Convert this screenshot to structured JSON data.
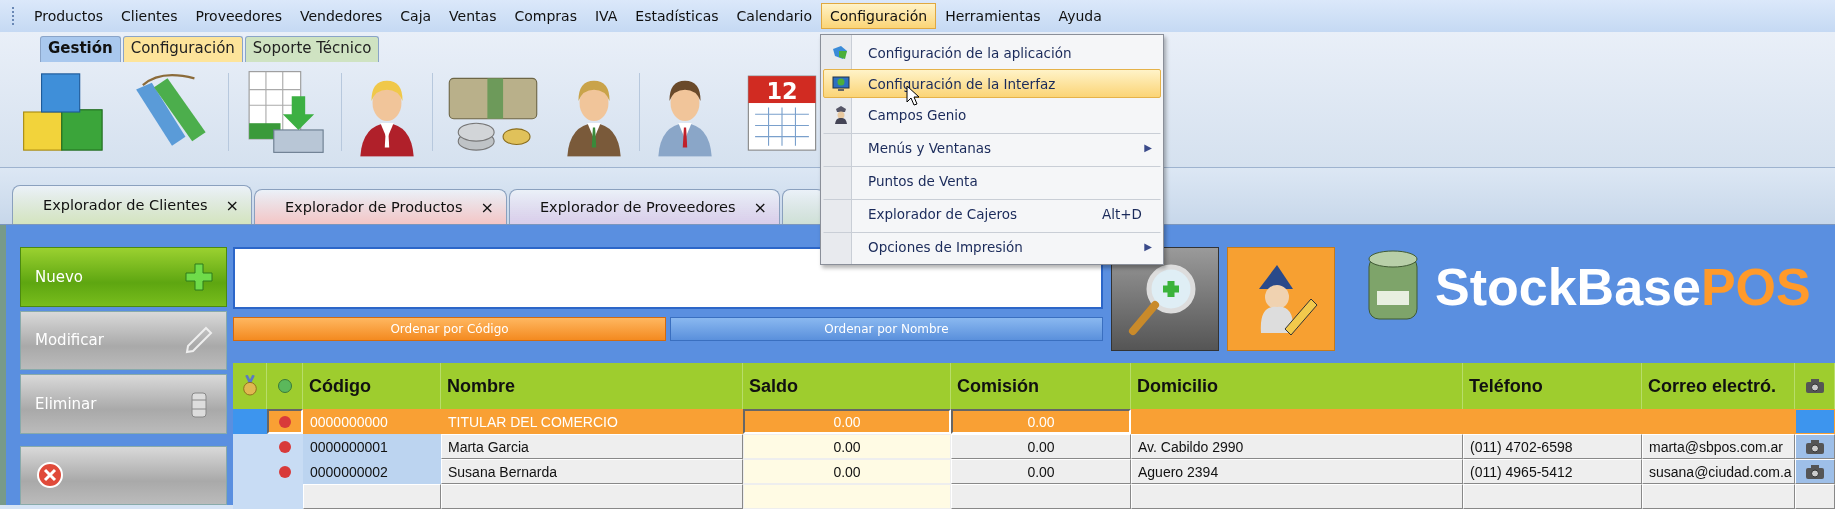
{
  "menu_bar": {
    "items": [
      {
        "label": "Productos",
        "selected": false
      },
      {
        "label": "Clientes",
        "selected": false
      },
      {
        "label": "Proveedores",
        "selected": false
      },
      {
        "label": "Vendedores",
        "selected": false
      },
      {
        "label": "Caja",
        "selected": false
      },
      {
        "label": "Ventas",
        "selected": false
      },
      {
        "label": "Compras",
        "selected": false
      },
      {
        "label": "IVA",
        "selected": false
      },
      {
        "label": "Estadísticas",
        "selected": false
      },
      {
        "label": "Calendario",
        "selected": false
      },
      {
        "label": "Configuración",
        "selected": true
      },
      {
        "label": "Herramientas",
        "selected": false
      },
      {
        "label": "Ayuda",
        "selected": false
      }
    ]
  },
  "dropdown": {
    "items": [
      {
        "label": "Configuración de la aplicación",
        "selected": false,
        "separator_before": false
      },
      {
        "label": "Configuración de la Interfaz",
        "selected": true,
        "separator_before": false
      },
      {
        "label": "Campos Genio",
        "selected": false,
        "separator_before": false
      },
      {
        "label": "Menús y Ventanas",
        "selected": false,
        "arrow": "▶",
        "separator_before": true
      },
      {
        "label": "Puntos de Venta",
        "selected": false,
        "separator_before": true
      },
      {
        "label": "Explorador de Cajeros",
        "shortcut": "Alt+D",
        "selected": false,
        "separator_before": true
      },
      {
        "label": "Opciones de Impresión",
        "selected": false,
        "arrow": "▶",
        "separator_before": true
      }
    ]
  },
  "calendar_day": "12",
  "ribbon_tabs": [
    {
      "label": "Gestión",
      "selected": true,
      "color": "#a9c8ee"
    },
    {
      "label": "Configuración",
      "selected": false,
      "color": "#fde49a"
    },
    {
      "label": "Soporte Técnico",
      "selected": false,
      "color": "#cfe3c2"
    }
  ],
  "document_tabs": [
    {
      "label": "Explorador de Clientes",
      "close": "×",
      "selected": true,
      "color": "#d4e4bf"
    },
    {
      "label": "Explorador de Productos",
      "close": "×",
      "selected": false,
      "color": "#f4c6c6"
    },
    {
      "label": "Explorador de Proveedores",
      "close": "×",
      "selected": false,
      "color": "#d9cdea"
    },
    {
      "selected": false,
      "color": "#cfe0d6"
    }
  ],
  "actions": [
    {
      "label": "Nuevo",
      "kind": "new"
    },
    {
      "label": "Modificar",
      "kind": "edit"
    },
    {
      "label": "Eliminar",
      "kind": "delete"
    },
    {
      "kind": "cancel"
    }
  ],
  "sort_buttons": [
    {
      "label": "Ordenar por Código",
      "selected": true
    },
    {
      "label": "Ordenar por Nombre",
      "selected": false
    }
  ],
  "logo": {
    "primary": "StockBase",
    "accent": "POS"
  },
  "table": {
    "columns": [
      "Código",
      "Nombre",
      "Saldo",
      "Comisión",
      "Domicilio",
      "Teléfono",
      "Correo electró."
    ],
    "rows": [
      {
        "selected": true,
        "color": "#d83a3a",
        "cells": [
          "0000000000",
          "TITULAR DEL COMERCIO",
          "0.00",
          "0.00",
          "",
          "",
          ""
        ],
        "photo": false
      },
      {
        "selected": false,
        "color": "#d83a3a",
        "cells": [
          "0000000001",
          "Marta Garcia",
          "0.00",
          "0.00",
          "Av. Cabildo 2990",
          "(011) 4702-6598",
          "marta@sbpos.com.ar"
        ],
        "photo": true
      },
      {
        "selected": false,
        "color": "#d83a3a",
        "cells": [
          "0000000002",
          "Susana Bernarda",
          "0.00",
          "0.00",
          "Aguero 2394",
          "(011) 4965-5412",
          "susana@ciudad.com.a"
        ],
        "photo": true
      }
    ]
  }
}
